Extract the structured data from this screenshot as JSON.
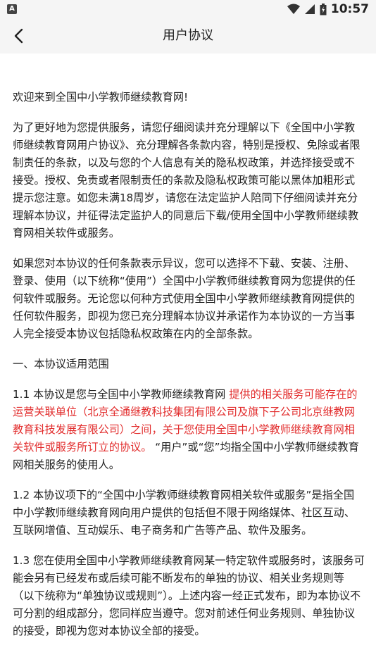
{
  "status_bar": {
    "left_badge": "A",
    "time": "10:57"
  },
  "header": {
    "title": "用户协议",
    "back_icon": "chevron-left-icon"
  },
  "colors": {
    "highlight": "#e22d2d",
    "header_bg": "#f5f5f5"
  },
  "body": {
    "p1": "欢迎来到全国中小学教师继续教育网!",
    "p2": "为了更好地为您提供服务，请您仔细阅读并充分理解以下《全国中小学教师继续教育网用户协议》、充分理解各条款内容，特别是授权、免除或者限制责任的条款，以及与您的个人信息有关的隐私权政策，并选择接受或不接受。授权、免责或者限制责任的条款及隐私权政策可能以黑体加粗形式提示您注意。如您未满18周岁，请您在法定监护人陪同下仔细阅读并充分理解本协议，并征得法定监护人的同意后下载/使用全国中小学教师继续教育网相关软件或服务。",
    "p3": "如果您对本协议的任何条款表示异议，您可以选择不下载、安装、注册、登录、使用（以下统称“使用”）全国中小学教师继续教育网为您提供的任何软件或服务。无论您以何种方式使用全国中小学教师继续教育网提供的任何软件服务，即视为您已充分理解本协议并承诺作为本协议的一方当事人完全接受本协议包括隐私权政策在内的全部条款。",
    "section1_heading": "一、本协议适用范围",
    "s1_1_a": "1.1 本协议是您与全国中小学教师继续教育网",
    "s1_1_red": "提供的相关服务可能存在的运营关联单位（北京全通继教科技集团有限公司及旗下子公司北京继教网教育科技发展有限公司）之间，关于您使用全国中小学教师继续教育网相关软件或服务所订立的协议。",
    "s1_1_b": "“用户”或“您”均指全国中小学教师继续教育网相关服务的使用人。",
    "s1_2": "1.2 本协议项下的“全国中小学教师继续教育网相关软件或服务”是指全国中小学教师继续教育网向用户提供的包括但不限于网络媒体、社区互动、互联网增值、互动娱乐、电子商务和广告等产品、软件及服务。",
    "s1_3": "1.3 您在使用全国中小学教师继续教育网某一特定软件或服务时，该服务可能会另有已经发布或后续可能不断发布的单独的协议、相关业务规则等（以下统称为“单独协议或规则”）。上述内容一经正式发布，即为本协议不可分割的组成部分，您同样应当遵守。您对前述任何业务规则、单独协议的接受，即视为您对本协议全部的接受。"
  }
}
